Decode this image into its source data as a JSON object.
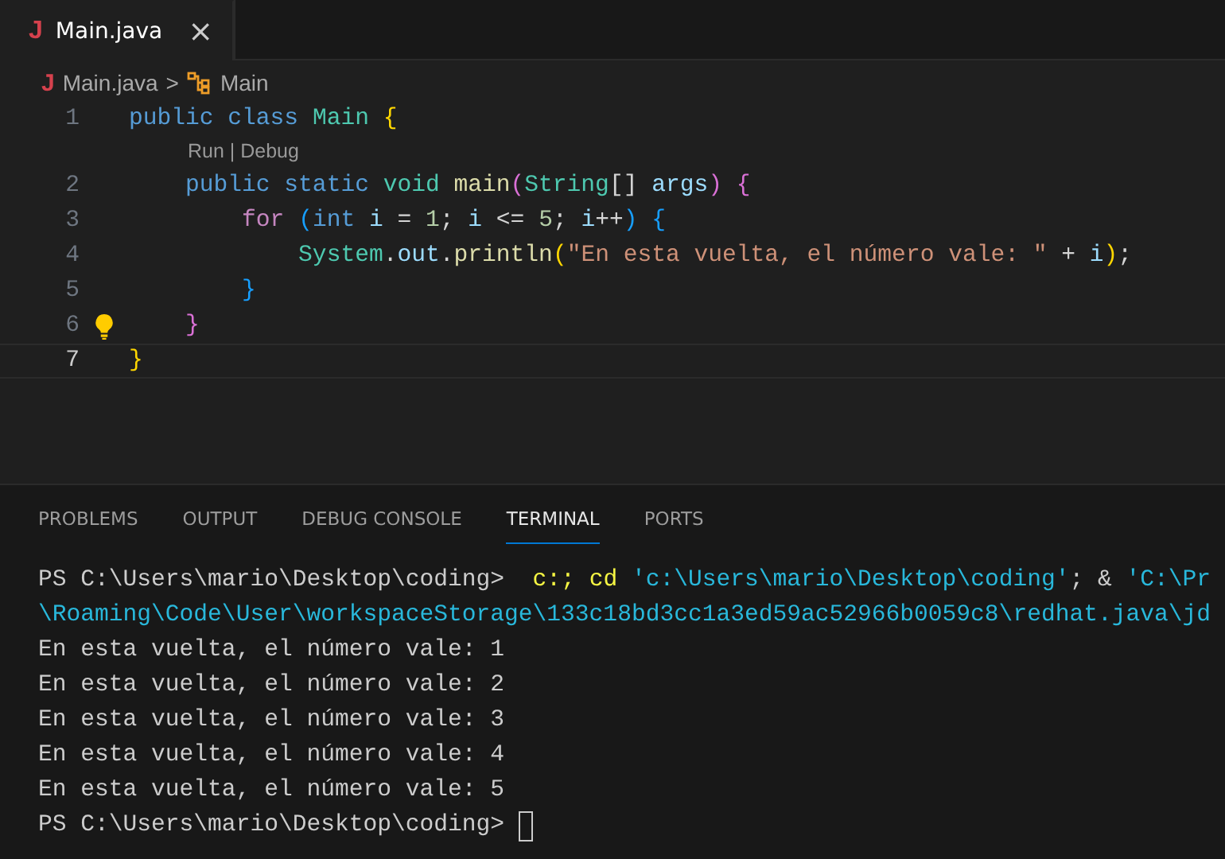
{
  "tabs": [
    {
      "label": "Main.java",
      "icon": "J",
      "selected": true,
      "close": "×"
    }
  ],
  "breadcrumb": {
    "file_icon": "J",
    "file": "Main.java",
    "separator": ">",
    "symbol": "Main"
  },
  "editor": {
    "lines": [
      {
        "number": "1",
        "current": false,
        "lightbulb": false,
        "tokens": [
          {
            "text": "public class",
            "kind": "keyword"
          },
          {
            "text": " Main",
            "kind": "type"
          },
          {
            "text": " {",
            "kind": "bracket1"
          }
        ],
        "codelens": "Run | Debug"
      },
      {
        "number": "2",
        "current": false,
        "lightbulb": false,
        "tokens": [
          {
            "text": "    public static",
            "kind": "keyword"
          },
          {
            "text": " void",
            "kind": "type"
          },
          {
            "text": " main",
            "kind": "func"
          },
          {
            "text": "(",
            "kind": "bracket2"
          },
          {
            "text": "String",
            "kind": "type"
          },
          {
            "text": "[]",
            "kind": "plain"
          },
          {
            "text": " args",
            "kind": "var"
          },
          {
            "text": ")",
            "kind": "bracket2"
          },
          {
            "text": " {",
            "kind": "bracket2"
          }
        ]
      },
      {
        "number": "3",
        "current": false,
        "lightbulb": false,
        "tokens": [
          {
            "text": "        for",
            "kind": "control"
          },
          {
            "text": " (",
            "kind": "bracket3"
          },
          {
            "text": "int",
            "kind": "keyword"
          },
          {
            "text": " i",
            "kind": "var"
          },
          {
            "text": " =",
            "kind": "plain"
          },
          {
            "text": " 1",
            "kind": "number"
          },
          {
            "text": ";",
            "kind": "plain"
          },
          {
            "text": " i",
            "kind": "var"
          },
          {
            "text": " <=",
            "kind": "plain"
          },
          {
            "text": " 5",
            "kind": "number"
          },
          {
            "text": ";",
            "kind": "plain"
          },
          {
            "text": " i",
            "kind": "var"
          },
          {
            "text": "++",
            "kind": "plain"
          },
          {
            "text": ")",
            "kind": "bracket3"
          },
          {
            "text": " {",
            "kind": "bracket3"
          }
        ]
      },
      {
        "number": "4",
        "current": false,
        "lightbulb": false,
        "tokens": [
          {
            "text": "            System",
            "kind": "type"
          },
          {
            "text": ".",
            "kind": "plain"
          },
          {
            "text": "out",
            "kind": "var"
          },
          {
            "text": ".",
            "kind": "plain"
          },
          {
            "text": "println",
            "kind": "func"
          },
          {
            "text": "(",
            "kind": "bracket1"
          },
          {
            "text": "\"En esta vuelta, el número vale: \"",
            "kind": "string"
          },
          {
            "text": " +",
            "kind": "plain"
          },
          {
            "text": " i",
            "kind": "var"
          },
          {
            "text": ")",
            "kind": "bracket1"
          },
          {
            "text": ";",
            "kind": "plain"
          }
        ]
      },
      {
        "number": "5",
        "current": false,
        "lightbulb": false,
        "tokens": [
          {
            "text": "        }",
            "kind": "bracket3"
          }
        ]
      },
      {
        "number": "6",
        "current": false,
        "lightbulb": true,
        "tokens": [
          {
            "text": "    }",
            "kind": "bracket2"
          }
        ]
      },
      {
        "number": "7",
        "current": true,
        "lightbulb": false,
        "tokens": [
          {
            "text": "}",
            "kind": "bracket1"
          }
        ]
      }
    ]
  },
  "panel": {
    "tabs": [
      {
        "label": "PROBLEMS",
        "selected": false
      },
      {
        "label": "OUTPUT",
        "selected": false
      },
      {
        "label": "DEBUG CONSOLE",
        "selected": false
      },
      {
        "label": "TERMINAL",
        "selected": true
      },
      {
        "label": "PORTS",
        "selected": false
      }
    ],
    "terminal": [
      {
        "cursor": false,
        "segments": [
          {
            "text": "PS C:\\Users\\mario\\Desktop\\coding>",
            "kind": "plain"
          },
          {
            "text": "  c:;",
            "kind": "command"
          },
          {
            "text": " cd",
            "kind": "command"
          },
          {
            "text": " 'c:\\Users\\mario\\Desktop\\coding'",
            "kind": "string"
          },
          {
            "text": "; &",
            "kind": "plain"
          },
          {
            "text": " 'C:\\Pr",
            "kind": "string"
          }
        ]
      },
      {
        "cursor": false,
        "segments": [
          {
            "text": "\\Roaming\\Code\\User\\workspaceStorage\\133c18bd3cc1a3ed59ac52966b0059c8\\redhat.java\\jd",
            "kind": "string"
          }
        ]
      },
      {
        "cursor": false,
        "segments": [
          {
            "text": "En esta vuelta, el número vale: 1",
            "kind": "plain"
          }
        ]
      },
      {
        "cursor": false,
        "segments": [
          {
            "text": "En esta vuelta, el número vale: 2",
            "kind": "plain"
          }
        ]
      },
      {
        "cursor": false,
        "segments": [
          {
            "text": "En esta vuelta, el número vale: 3",
            "kind": "plain"
          }
        ]
      },
      {
        "cursor": false,
        "segments": [
          {
            "text": "En esta vuelta, el número vale: 4",
            "kind": "plain"
          }
        ]
      },
      {
        "cursor": false,
        "segments": [
          {
            "text": "En esta vuelta, el número vale: 5",
            "kind": "plain"
          }
        ]
      },
      {
        "cursor": true,
        "segments": [
          {
            "text": "PS C:\\Users\\mario\\Desktop\\coding>",
            "kind": "plain"
          }
        ]
      }
    ]
  }
}
